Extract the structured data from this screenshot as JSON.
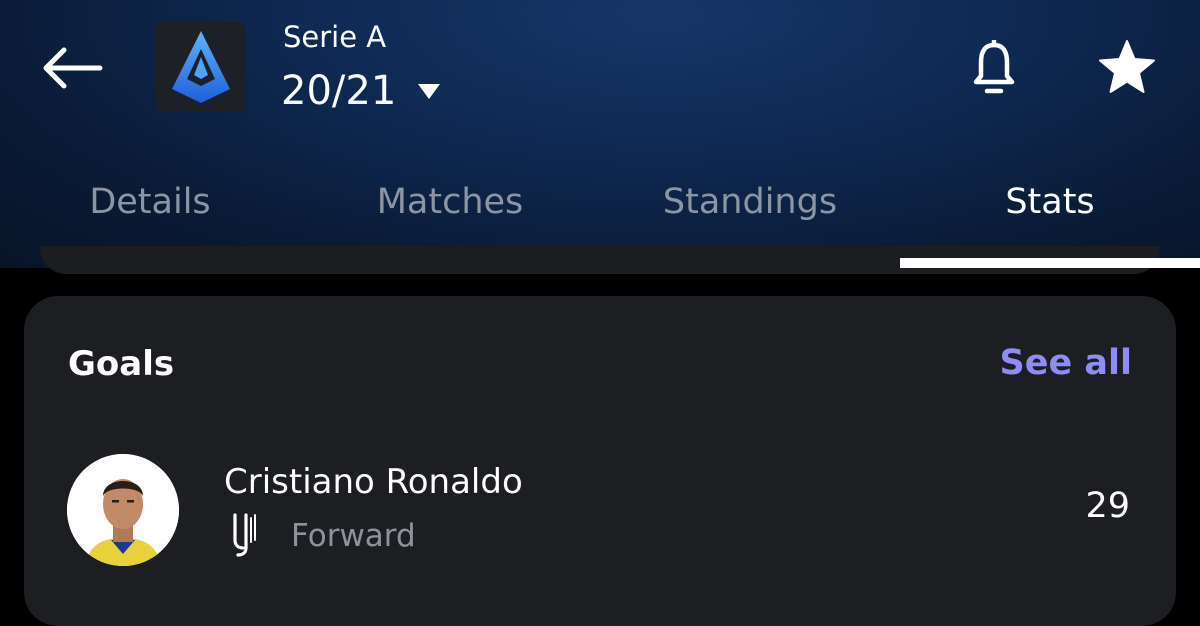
{
  "header": {
    "league_name": "Serie A",
    "season": "20/21",
    "icons": {
      "back": "arrow-left-icon",
      "league_logo": "serie-a-logo",
      "season_dropdown": "caret-down-icon",
      "notifications": "bell-icon",
      "favorite": "star-icon"
    }
  },
  "tabs": [
    {
      "label": "Details",
      "active": false
    },
    {
      "label": "Matches",
      "active": false
    },
    {
      "label": "Standings",
      "active": false
    },
    {
      "label": "Stats",
      "active": true
    }
  ],
  "stats_card": {
    "title": "Goals",
    "see_all_label": "See all",
    "players": [
      {
        "name": "Cristiano Ronaldo",
        "team_logo": "juventus-logo",
        "position": "Forward",
        "value": "29"
      }
    ]
  },
  "colors": {
    "header_bg": "#0f2a55",
    "page_bg": "#000000",
    "card_bg": "#1c1e22",
    "accent": "#8e8cf5",
    "inactive_tab": "#8c95a3",
    "secondary_text": "#8e939b",
    "logo_blue": "#2f7df6"
  }
}
